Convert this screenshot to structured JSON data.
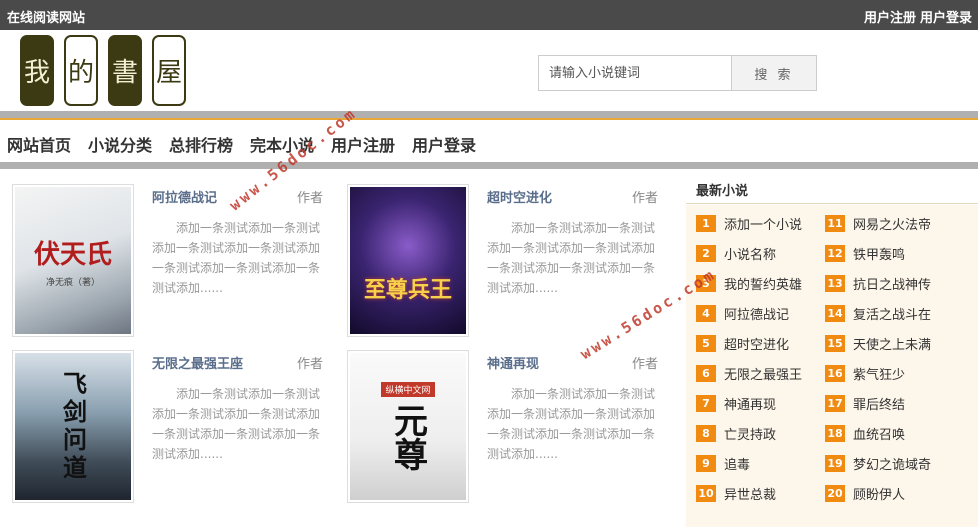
{
  "topbar": {
    "site_name": "在线阅读网站",
    "register": "用户注册",
    "login": "用户登录"
  },
  "logo": {
    "chars": [
      "我",
      "的",
      "書",
      "屋"
    ]
  },
  "search": {
    "placeholder": "请输入小说键词",
    "button": "搜 索"
  },
  "nav": {
    "items": [
      "网站首页",
      "小说分类",
      "总排行榜",
      "完本小说",
      "用户注册",
      "用户登录"
    ]
  },
  "books": [
    {
      "title": "阿拉德战记",
      "author_label": "作者",
      "desc": "添加一条测试添加一条测试添加一条测试添加一条测试添加一条测试添加一条测试添加一条测试添加......",
      "cover_text": "伏天氏",
      "cover_sub": "净无痕（著）"
    },
    {
      "title": "超时空进化",
      "author_label": "作者",
      "desc": "添加一条测试添加一条测试添加一条测试添加一条测试添加一条测试添加一条测试添加一条测试添加......",
      "cover_text": "至尊兵王"
    },
    {
      "title": "无限之最强王座",
      "author_label": "作者",
      "desc": "添加一条测试添加一条测试添加一条测试添加一条测试添加一条测试添加一条测试添加一条测试添加......",
      "cover_text": "飞剑问道"
    },
    {
      "title": "神通再现",
      "author_label": "作者",
      "desc": "添加一条测试添加一条测试添加一条测试添加一条测试添加一条测试添加一条测试添加一条测试添加......",
      "cover_text": "元尊",
      "cover_sub": "纵横中文网"
    }
  ],
  "rank": {
    "title": "最新小说",
    "left": [
      {
        "num": "1",
        "name": "添加一个小说"
      },
      {
        "num": "2",
        "name": "小说名称"
      },
      {
        "num": "3",
        "name": "我的誓约英雄"
      },
      {
        "num": "4",
        "name": "阿拉德战记"
      },
      {
        "num": "5",
        "name": "超时空进化"
      },
      {
        "num": "6",
        "name": "无限之最强王"
      },
      {
        "num": "7",
        "name": "神通再现"
      },
      {
        "num": "8",
        "name": "亡灵持政"
      },
      {
        "num": "9",
        "name": "追毒"
      },
      {
        "num": "10",
        "name": "异世总裁"
      }
    ],
    "right": [
      {
        "num": "11",
        "name": "网易之火法帝"
      },
      {
        "num": "12",
        "name": "铁甲轰鸣"
      },
      {
        "num": "13",
        "name": "抗日之战神传"
      },
      {
        "num": "14",
        "name": "复活之战斗在"
      },
      {
        "num": "15",
        "name": "天使之上未满"
      },
      {
        "num": "16",
        "name": "紫气狂少"
      },
      {
        "num": "17",
        "name": "罪后终结"
      },
      {
        "num": "18",
        "name": "血统召唤"
      },
      {
        "num": "19",
        "name": "梦幻之诡域奇"
      },
      {
        "num": "20",
        "name": "顾盼伊人"
      }
    ]
  },
  "watermark": "www.56doc.com",
  "colors": {
    "topbar": "#4a4a4a",
    "accent": "#f08a10",
    "nav_bar": "#b0b0b0",
    "title_link": "#5a6e8c"
  }
}
